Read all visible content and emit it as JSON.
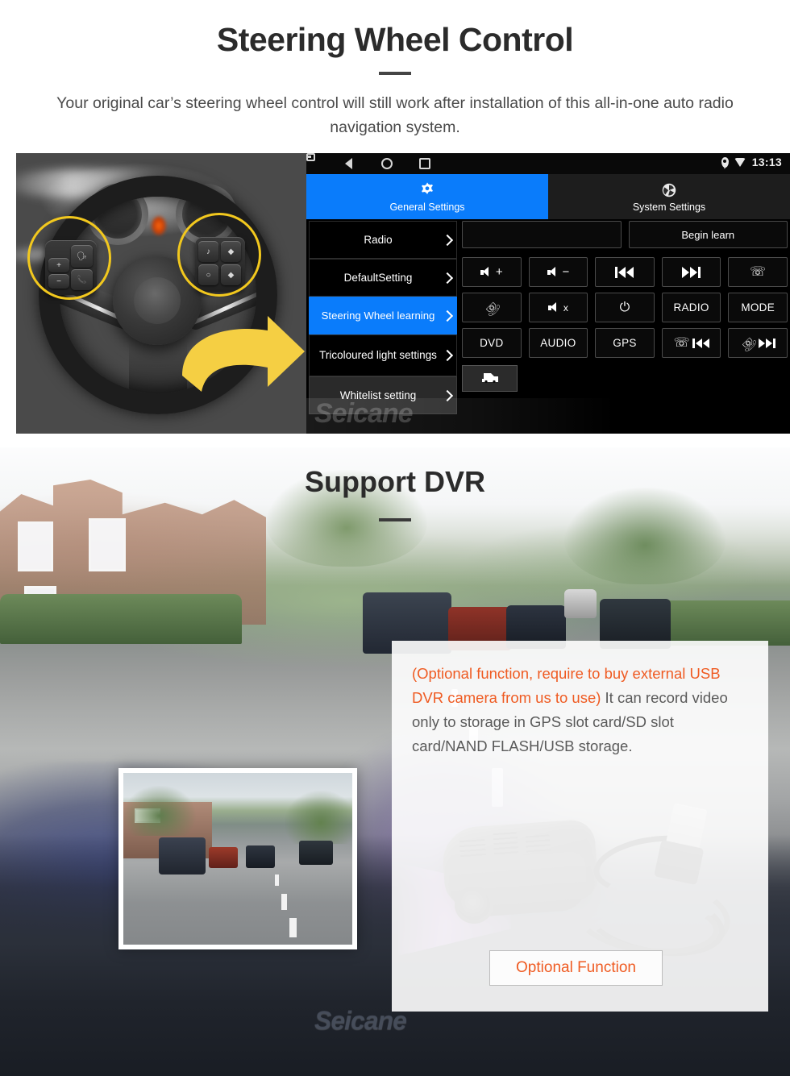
{
  "section1": {
    "title": "Steering Wheel Control",
    "subtitle": "Your original car’s steering wheel control will still work after installation of this all-in-one auto radio navigation system.",
    "head_unit": {
      "status_bar": {
        "time": "13:13",
        "icons": [
          "back-icon",
          "home-icon",
          "recent-apps-icon",
          "screenshot-icon",
          "location-pin-icon",
          "wifi-icon"
        ]
      },
      "tabs": [
        {
          "label": "General Settings",
          "icon": "gear-icon",
          "active": true
        },
        {
          "label": "System Settings",
          "icon": "system-settings-icon",
          "active": false
        }
      ],
      "menu": [
        {
          "label": "Radio",
          "selected": false
        },
        {
          "label": "DefaultSetting",
          "selected": false
        },
        {
          "label": "Steering Wheel learning",
          "selected": true
        },
        {
          "label": "Tricoloured light settings",
          "selected": false
        },
        {
          "label": "Whitelist setting",
          "selected": false
        }
      ],
      "input_value": "",
      "input_placeholder": "",
      "begin_learn_label": "Begin learn",
      "buttons": [
        {
          "label": "",
          "icon": "volume-up-icon"
        },
        {
          "label": "",
          "icon": "volume-down-icon"
        },
        {
          "label": "",
          "icon": "previous-track-icon"
        },
        {
          "label": "",
          "icon": "next-track-icon"
        },
        {
          "label": "",
          "icon": "phone-answer-icon"
        },
        {
          "label": "",
          "icon": "phone-hangup-icon"
        },
        {
          "label": "",
          "icon": "mute-icon"
        },
        {
          "label": "",
          "icon": "power-icon"
        },
        {
          "label": "RADIO",
          "icon": ""
        },
        {
          "label": "MODE",
          "icon": ""
        },
        {
          "label": "DVD",
          "icon": ""
        },
        {
          "label": "AUDIO",
          "icon": ""
        },
        {
          "label": "GPS",
          "icon": ""
        },
        {
          "label": "",
          "icon": "phone-previous-icon"
        },
        {
          "label": "",
          "icon": "phone-reject-next-icon"
        }
      ],
      "car_button_icon": "car-icon"
    },
    "watermark": "Seicane"
  },
  "section2": {
    "title": "Support DVR",
    "card": {
      "highlight_text": "(Optional function, require to buy external USB DVR camera from us to use)",
      "body_text": "It can record video only to storage in GPS slot card/SD slot card/NAND FLASH/USB storage.",
      "button_label": "Optional Function"
    },
    "watermark": "Seicane",
    "device_icon": "usb-dvr-camera"
  },
  "colors": {
    "accent_blue": "#0a7cfb",
    "accent_orange": "#ef5b22",
    "highlight_yellow": "#f2c81e",
    "heading": "#2b2b2b",
    "body_text": "#4a4a4a"
  }
}
